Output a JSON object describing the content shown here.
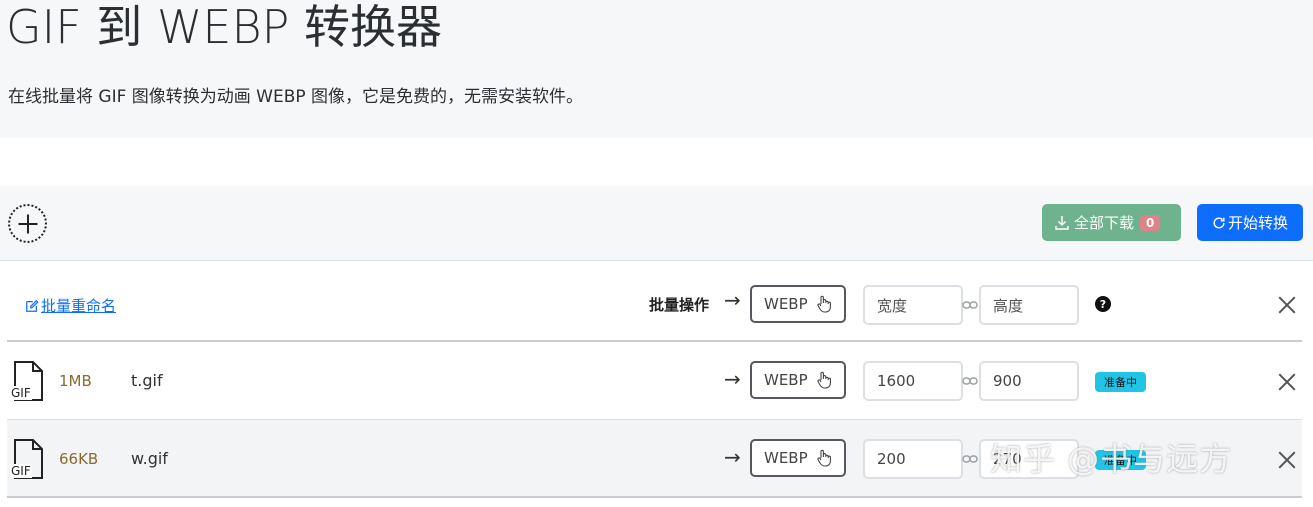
{
  "hero": {
    "title": "GIF 到 WEBP 转换器",
    "subtitle": "在线批量将 GIF 图像转换为动画 WEBP 图像，它是免费的，无需安装软件。"
  },
  "toolbar": {
    "download_label": "全部下载",
    "download_count": "0",
    "start_label": "开始转换"
  },
  "batch": {
    "rename_label": "批量重命名",
    "ops_label": "批量操作",
    "format": "WEBP",
    "width_placeholder": "宽度",
    "height_placeholder": "高度",
    "help": "?"
  },
  "files": [
    {
      "ext": "GIF",
      "size": "1MB",
      "name": "t.gif",
      "format": "WEBP",
      "width": "1600",
      "height": "900",
      "status": "准备中"
    },
    {
      "ext": "GIF",
      "size": "66KB",
      "name": "w.gif",
      "format": "WEBP",
      "width": "200",
      "height": "270",
      "status": "准备中"
    }
  ],
  "watermark": "知乎 @书与远方",
  "colors": {
    "primary": "#0d6efd",
    "success_muted": "#6fb38e",
    "badge_count": "#e0818c",
    "status_info": "#22c4e6",
    "file_size": "#8a6a2e"
  }
}
